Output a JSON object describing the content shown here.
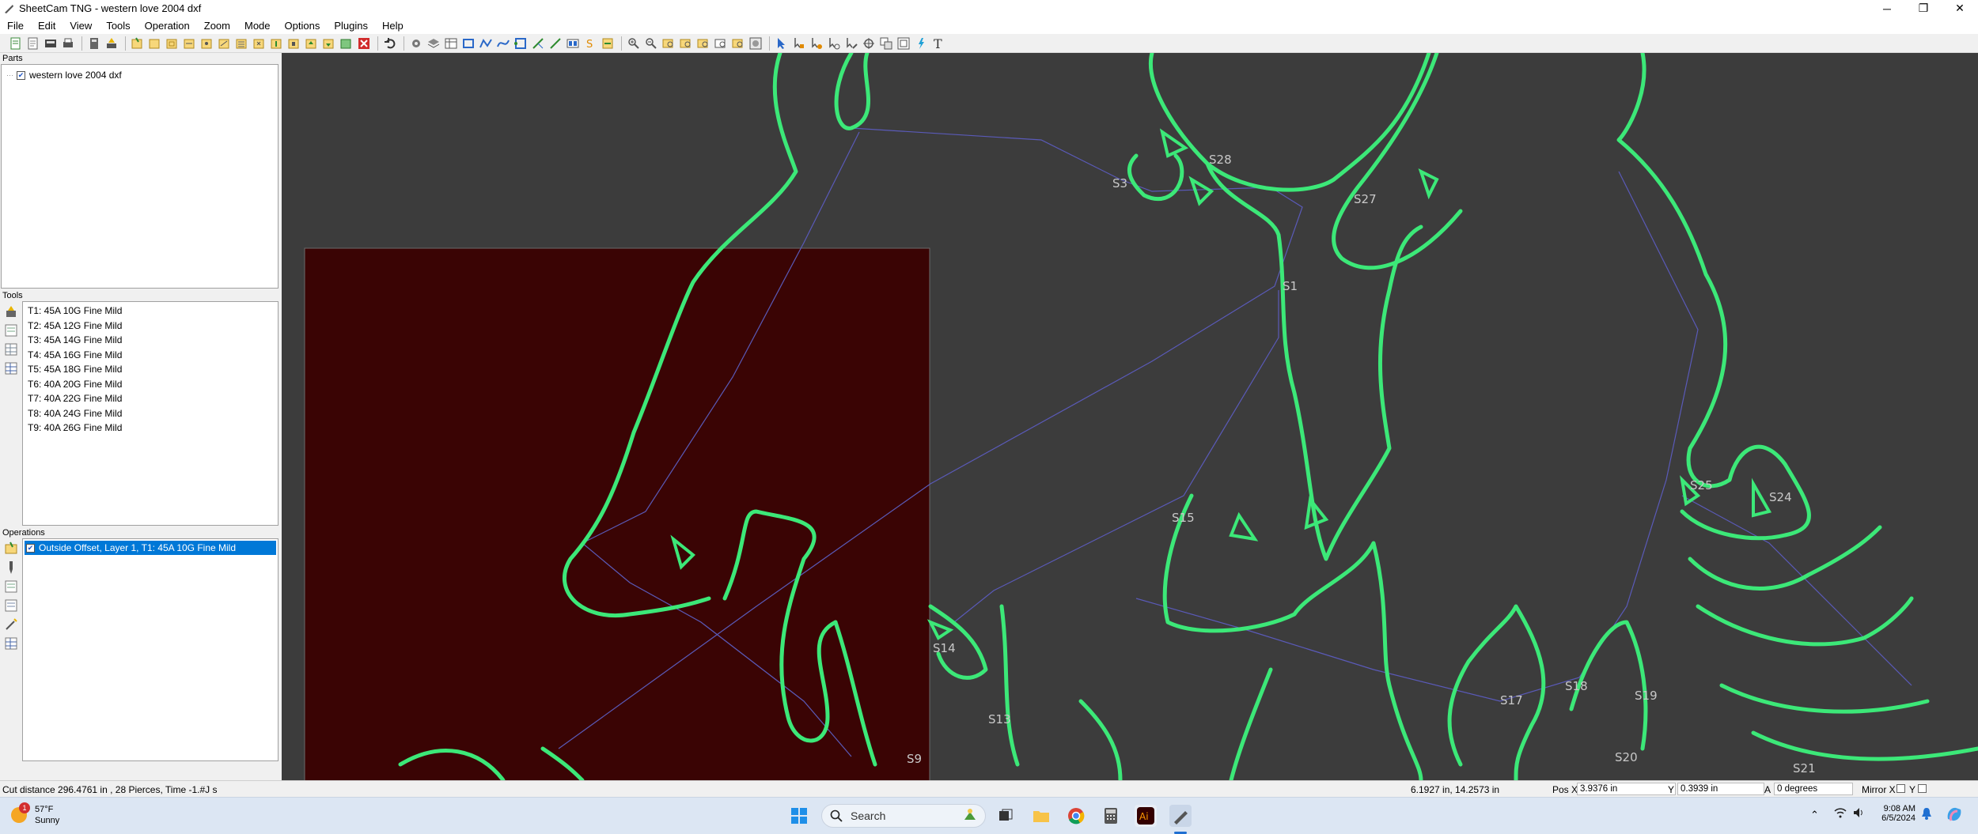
{
  "window": {
    "title": "SheetCam TNG - western love 2004 dxf",
    "controls": [
      "minimize-icon",
      "restore-icon",
      "close-icon"
    ]
  },
  "menu": [
    "File",
    "Edit",
    "View",
    "Tools",
    "Operation",
    "Zoom",
    "Mode",
    "Options",
    "Plugins",
    "Help"
  ],
  "panels": {
    "parts": {
      "title": "Parts",
      "items": [
        {
          "label": "western love 2004 dxf",
          "checked": true
        }
      ]
    },
    "tools": {
      "title": "Tools",
      "items": [
        "T1: 45A 10G Fine Mild",
        "T2: 45A 12G Fine Mild",
        "T3: 45A 14G Fine Mild",
        "T4: 45A 16G Fine Mild",
        "T5: 45A 18G Fine Mild",
        "T6: 40A 20G Fine Mild",
        "T7: 40A 22G Fine Mild",
        "T8: 40A 24G Fine Mild",
        "T9: 40A 26G Fine Mild"
      ]
    },
    "operations": {
      "title": "Operations",
      "items": [
        {
          "label": "Outside Offset, Layer 1, T1: 45A 10G Fine Mild",
          "checked": true,
          "selected": true
        }
      ]
    }
  },
  "canvas": {
    "colors": {
      "background": "#3c3c3c",
      "sheet": "#3a0404",
      "path": "#3ce878",
      "rapid": "#5a5ab8"
    },
    "labels": [
      "S28",
      "S3",
      "S27",
      "S1",
      "S15",
      "S25",
      "S24",
      "S14",
      "S13",
      "S9",
      "S17",
      "S18",
      "S19",
      "S20",
      "S21"
    ]
  },
  "status": {
    "cut_info": "Cut distance 296.4761 in , 28 Pierces, Time -1.#J s",
    "cursor": "6.1927 in, 14.2573 in",
    "pos_x_label": "Pos X",
    "pos_x": "3.9376 in",
    "pos_y_label": "Y",
    "pos_y": "0.3939 in",
    "angle_label": "A",
    "angle": "0 degrees",
    "mirror_x_label": "Mirror X",
    "mirror_y_label": "Y"
  },
  "taskbar": {
    "weather_temp": "57°F",
    "weather_desc": "Sunny",
    "weather_badge": "1",
    "search_placeholder": "Search",
    "time": "9:08 AM",
    "date": "6/5/2024"
  }
}
